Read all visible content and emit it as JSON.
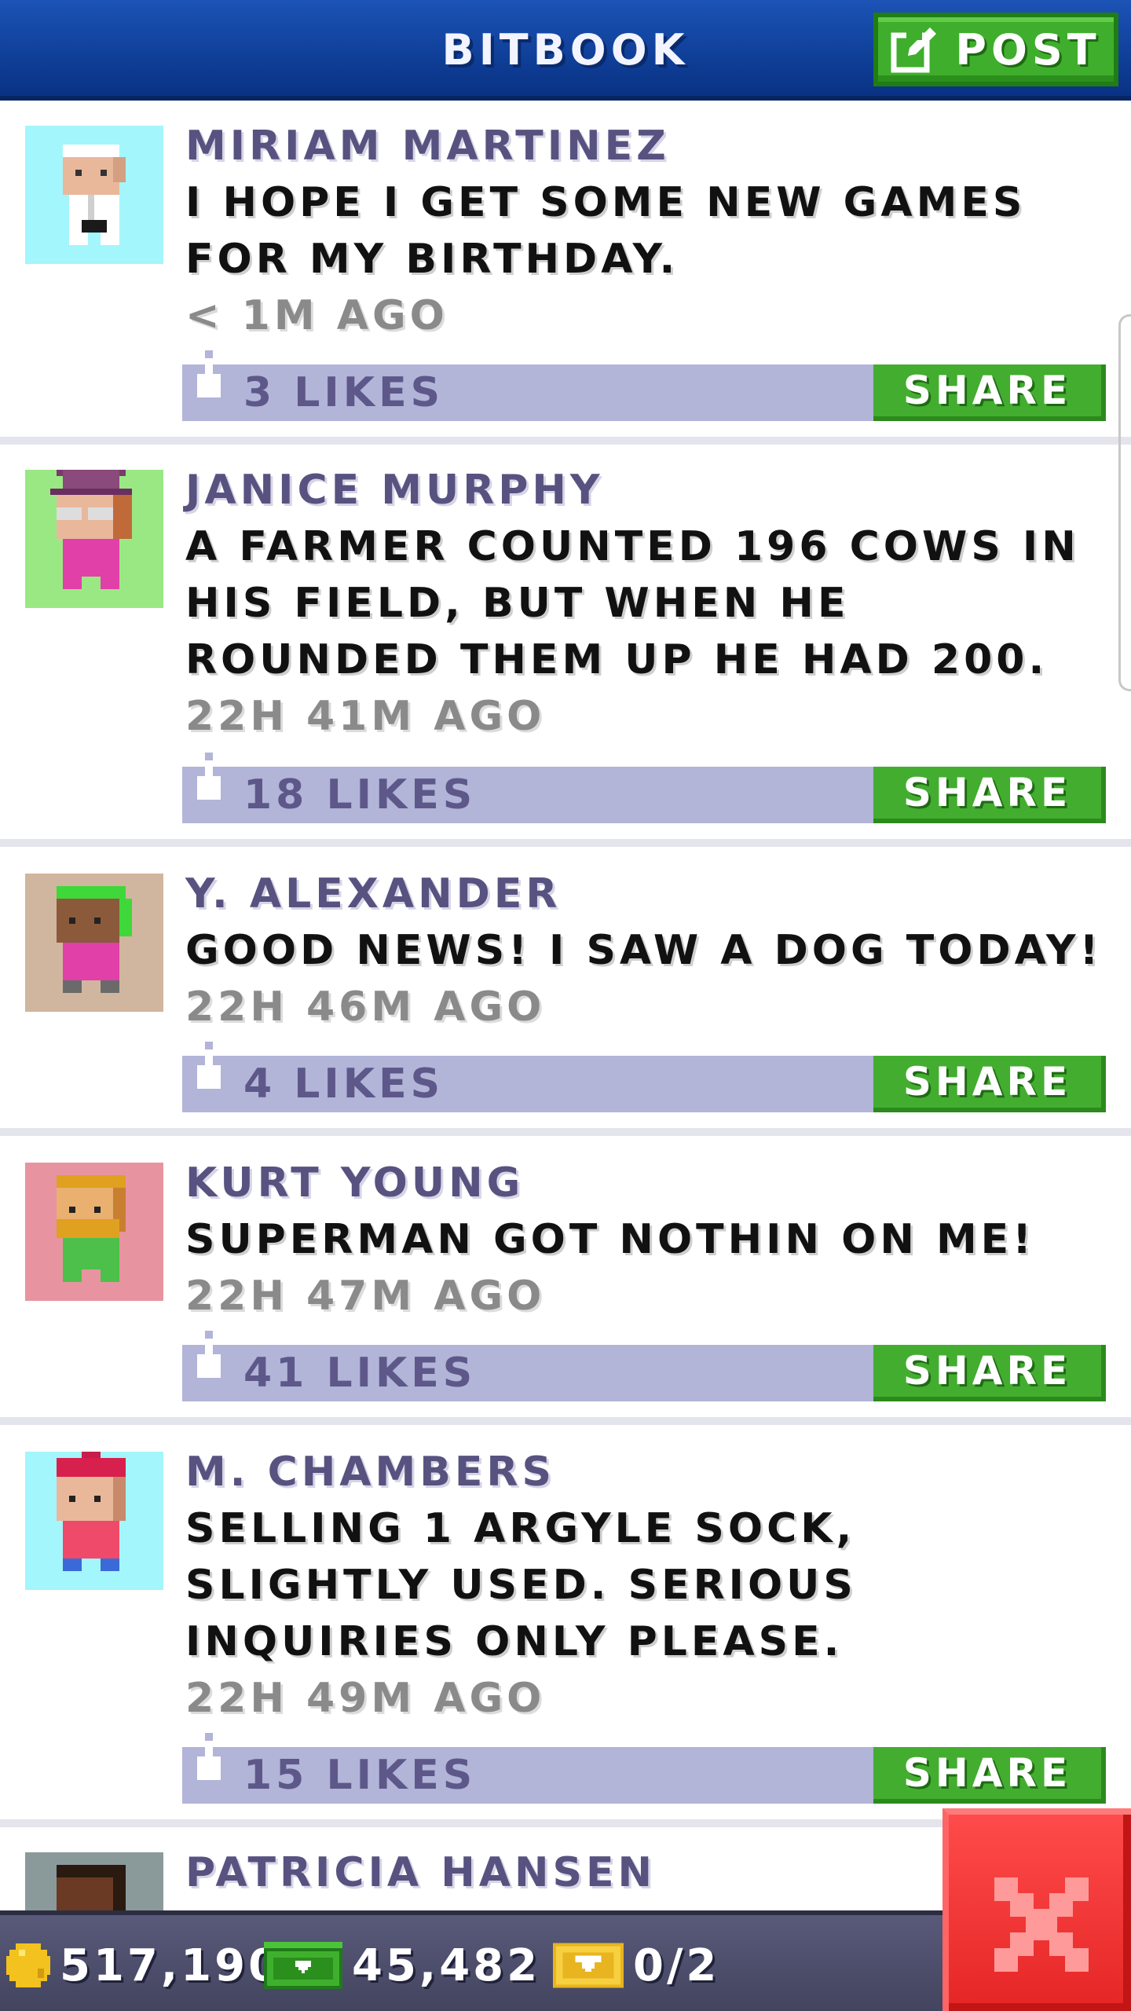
{
  "header": {
    "title": "BITBOOK",
    "post_label": "POST"
  },
  "feed": [
    {
      "author": "MIRIAM MARTINEZ",
      "message": "I HOPE I GET SOME NEW GAMES FOR MY BIRTHDAY.",
      "time": "< 1M AGO",
      "likes": "3 LIKES",
      "share": "SHARE",
      "avatar_bg": "#a3f6fb"
    },
    {
      "author": "JANICE MURPHY",
      "message": "A FARMER COUNTED 196 COWS IN HIS FIELD, BUT WHEN HE ROUNDED THEM UP HE HAD 200.",
      "time": "22H 41M AGO",
      "likes": "18 LIKES",
      "share": "SHARE",
      "avatar_bg": "#9ae884"
    },
    {
      "author": "Y. ALEXANDER",
      "message": "GOOD NEWS! I SAW A DOG TODAY!",
      "time": "22H 46M AGO",
      "likes": "4 LIKES",
      "share": "SHARE",
      "avatar_bg": "#d0b69e"
    },
    {
      "author": "KURT YOUNG",
      "message": "SUPERMAN GOT NOTHIN ON ME!",
      "time": "22H 47M AGO",
      "likes": "41 LIKES",
      "share": "SHARE",
      "avatar_bg": "#e894a0"
    },
    {
      "author": "M. CHAMBERS",
      "message": "SELLING 1 ARGYLE SOCK, SLIGHTLY USED. SERIOUS INQUIRIES ONLY PLEASE.",
      "time": "22H 49M AGO",
      "likes": "15 LIKES",
      "share": "SHARE",
      "avatar_bg": "#a3f6fb"
    },
    {
      "author": "PATRICIA HANSEN",
      "avatar_bg": "#8a9a9a"
    }
  ],
  "bottom_bar": {
    "coins": "517,190",
    "bux": "45,482",
    "tickets": "0/2"
  },
  "colors": {
    "header": "#0f3f98",
    "share_green": "#43ad30",
    "likes_bar": "#b2b4d8",
    "close_red": "#e52525"
  },
  "icons": {
    "post": "edit-icon",
    "like": "thumbs-up-icon",
    "coin": "coin-icon",
    "bux": "bux-icon",
    "ticket": "ticket-icon",
    "close": "close-icon"
  }
}
